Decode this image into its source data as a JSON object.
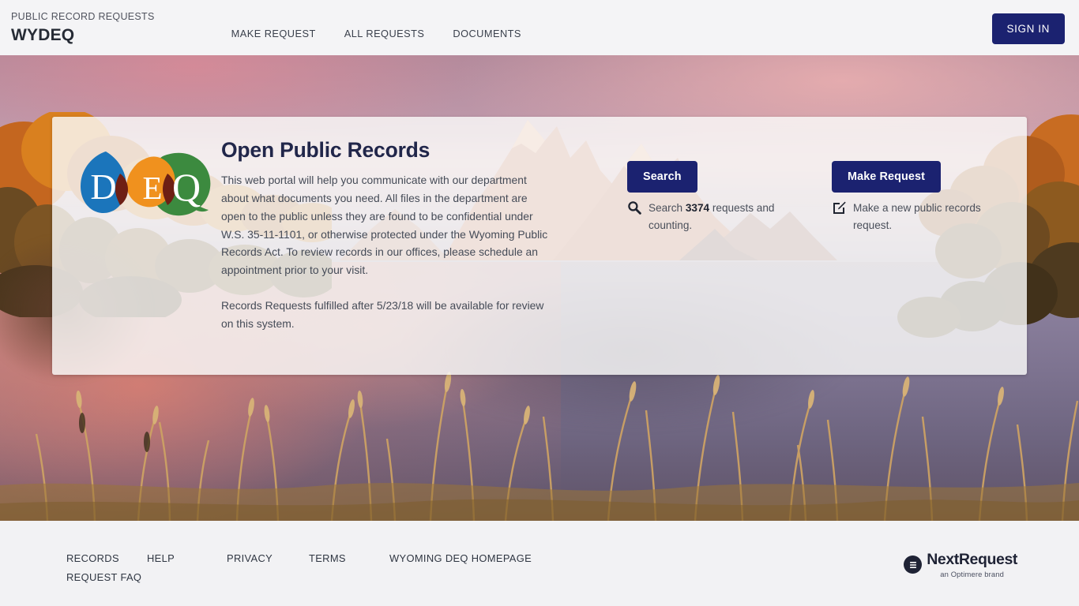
{
  "header": {
    "eyebrow": "PUBLIC RECORD REQUESTS",
    "title": "WYDEQ",
    "nav": [
      {
        "label": "MAKE REQUEST",
        "name": "nav-make-request"
      },
      {
        "label": "ALL REQUESTS",
        "name": "nav-all-requests"
      },
      {
        "label": "DOCUMENTS",
        "name": "nav-documents"
      }
    ],
    "sign_in_label": "SIGN IN",
    "accent_color": "#1b2270",
    "background_color": "#f4f4f6"
  },
  "hero": {
    "logo": {
      "alt": "DEQ",
      "letters": [
        "D",
        "E",
        "Q"
      ],
      "drop_color": "#1b75bb",
      "sun_color": "#f0911e",
      "leaf_color": "#3c8a3f"
    },
    "heading": "Open Public Records",
    "paragraphs": [
      "This web portal will help you communicate with our department about what documents you need. All files in the department are open to the public unless they are found to be confidential under W.S. 35-11-1101, or otherwise protected under the Wyoming Public Records Act. To review records in our offices, please schedule an appointment prior to your visit.",
      "Records Requests fulfilled after 5/23/18 will be available for review on this system."
    ],
    "actions": [
      {
        "name": "search",
        "button_label": "Search",
        "icon": "search-icon",
        "desc_prefix": "Search ",
        "desc_count": "3374",
        "desc_suffix": " requests and counting."
      },
      {
        "name": "make-request",
        "button_label": "Make Request",
        "icon": "edit-pencil-icon",
        "desc_prefix": "Make a new public records request.",
        "desc_count": "",
        "desc_suffix": ""
      }
    ]
  },
  "footer": {
    "links": [
      {
        "label": "RECORDS REQUEST FAQ",
        "name": "footer-link-records-request-faq"
      },
      {
        "label": "HELP",
        "name": "footer-link-help"
      },
      {
        "label": "PRIVACY",
        "name": "footer-link-privacy"
      },
      {
        "label": "TERMS",
        "name": "footer-link-terms"
      },
      {
        "label": "WYOMING DEQ HOMEPAGE",
        "name": "footer-link-wyoming-deq-homepage"
      }
    ],
    "brand": {
      "name": "NextRequest",
      "tagline": "an Optimere brand"
    },
    "background_color": "#f2f2f4"
  }
}
